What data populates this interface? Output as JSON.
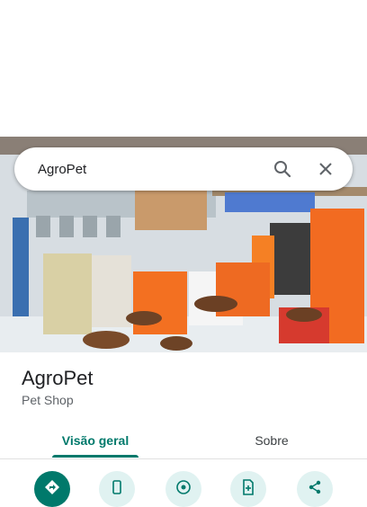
{
  "search": {
    "value": "AgroPet",
    "search_icon": "search-icon",
    "close_icon": "close-icon"
  },
  "place": {
    "name": "AgroPet",
    "category": "Pet Shop"
  },
  "tabs": [
    {
      "label": "Visão geral",
      "selected": true
    },
    {
      "label": "Sobre",
      "selected": false
    }
  ],
  "actions": [
    {
      "icon": "directions-icon"
    },
    {
      "icon": "phone-icon"
    },
    {
      "icon": "website-icon"
    },
    {
      "icon": "save-icon"
    },
    {
      "icon": "share-icon"
    }
  ],
  "colors": {
    "accent": "#00796b",
    "accent_light": "#e0f2f1",
    "text_primary": "#202124",
    "text_secondary": "#5f6368"
  }
}
